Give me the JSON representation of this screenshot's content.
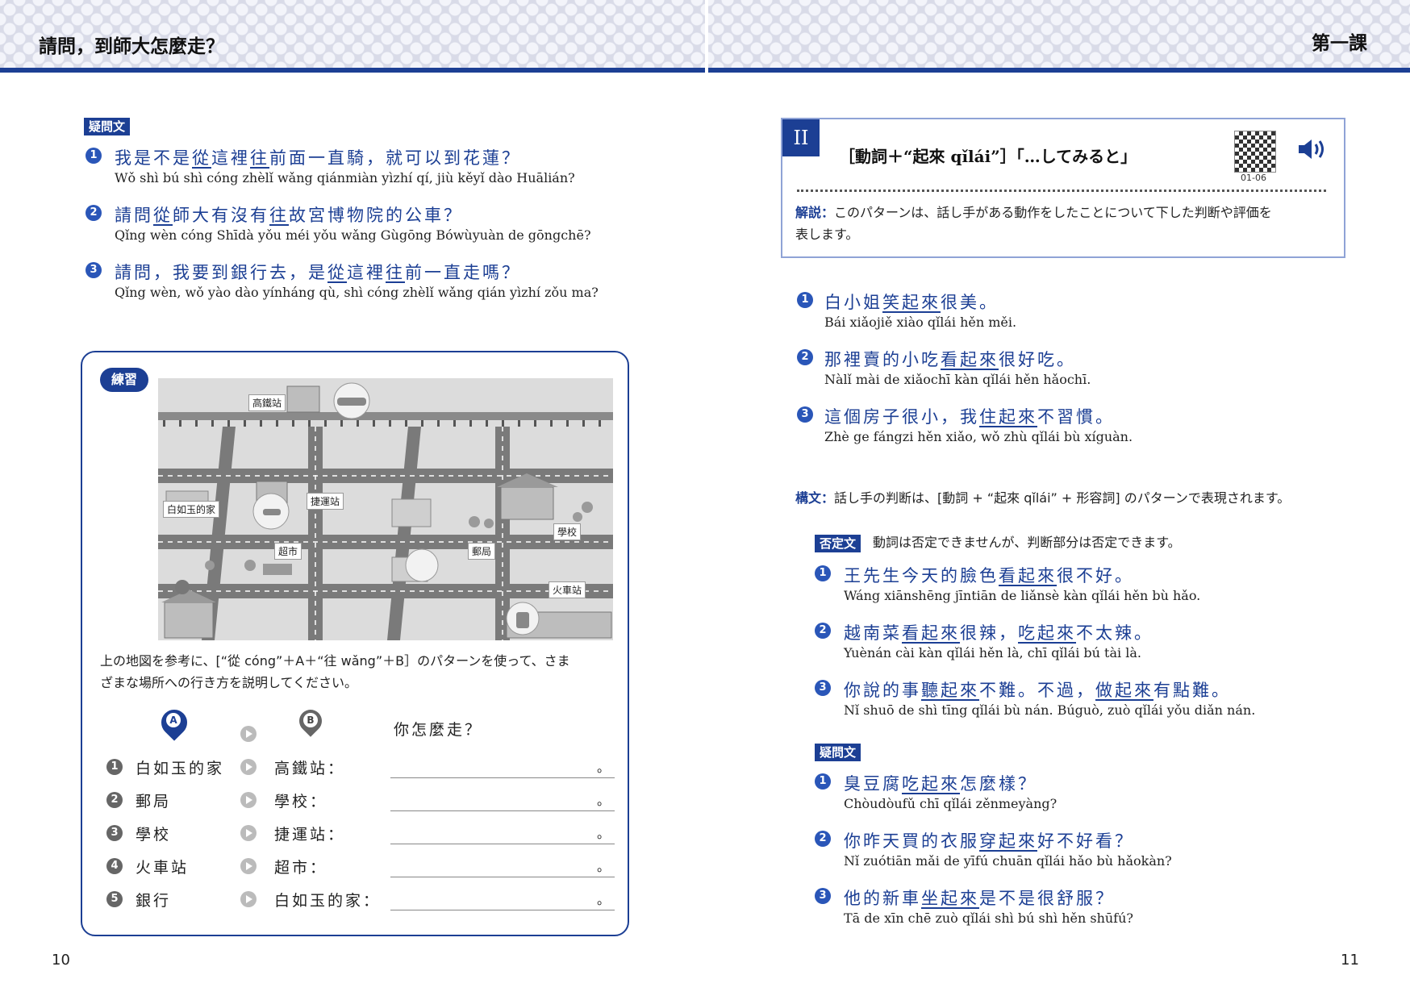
{
  "header": {
    "left_title": "請問，到師大怎麼走？",
    "right_title": "第一課"
  },
  "left": {
    "question_tag": "疑問文",
    "questions": [
      {
        "n": "❶",
        "zh_a": "我是不是",
        "zh_u1": "從",
        "zh_b": "這裡",
        "zh_u2": "往",
        "zh_c": "前面一直騎，就可以到花蓮？",
        "py": "Wǒ shì bú shì cóng zhèlǐ wǎng qiánmiàn yìzhí qí, jiù kěyǐ dào Huālián?"
      },
      {
        "n": "❷",
        "zh_a": "請問",
        "zh_u1": "從",
        "zh_b": "師大有沒有",
        "zh_u2": "往",
        "zh_c": "故宮博物院的公車？",
        "py": "Qǐng wèn cóng Shīdà yǒu méi yǒu wǎng Gùgōng Bówùyuàn de gōngchē?"
      },
      {
        "n": "❸",
        "zh_a": "請問，我要到銀行去，是",
        "zh_u1": "從",
        "zh_b": "這裡",
        "zh_u2": "往",
        "zh_c": "前一直走嗎？",
        "py": "Qǐng wèn, wǒ yào dào yínháng qù, shì cóng zhèlǐ wǎng qián yìzhí zǒu ma?"
      }
    ],
    "practice": {
      "tag": "練習",
      "map_labels": {
        "hsr": "高鐵站",
        "home": "白如玉的家",
        "mrt": "捷運站",
        "school": "學校",
        "market": "超市",
        "post": "郵局",
        "train": "火車站"
      },
      "instruction_1": "上の地図を参考に、[“從 cóng”＋A＋“往 wǎng”＋B］のパターンを使って、さま",
      "instruction_2": "ざまな場所への行き方を説明してください。",
      "pin_a": "A",
      "pin_b": "B",
      "question": "你怎麼走？",
      "rows": [
        {
          "n": "❶",
          "a": "白如玉的家",
          "b": "高鐵站：",
          "end": "。"
        },
        {
          "n": "❷",
          "a": "郵局",
          "b": "學校：",
          "end": "。"
        },
        {
          "n": "❸",
          "a": "學校",
          "b": "捷運站：",
          "end": "。"
        },
        {
          "n": "❹",
          "a": "火車站",
          "b": "超市：",
          "end": "。"
        },
        {
          "n": "❺",
          "a": "銀行",
          "b": "白如玉的家：",
          "end": "。"
        }
      ]
    },
    "page": "10"
  },
  "right": {
    "pattern": {
      "roman": "II",
      "title": "［動詞＋“起來 qǐlái”］「…してみると」",
      "code": "01-06",
      "expl_label": "解説：",
      "expl_1": "このパターンは、話し手がある動作をしたことについて下した判断や評価を",
      "expl_2": "表します。"
    },
    "examples": [
      {
        "n": "❶",
        "a": "白小姐",
        "u": "笑起來",
        "b": "很美。",
        "py": "Bái xiǎojiě xiào qǐlái hěn měi."
      },
      {
        "n": "❷",
        "a": "那裡賣的小吃",
        "u": "看起來",
        "b": "很好吃。",
        "py": "Nàlǐ mài de xiǎochī kàn qǐlái hěn hǎochī."
      },
      {
        "n": "❸",
        "a": "這個房子很小，我",
        "u": "住起來",
        "b": "不習慣。",
        "py": "Zhè ge fángzi hěn xiǎo, wǒ zhù qǐlái bù xíguàn."
      }
    ],
    "structure_label": "構文：",
    "structure_text": "話し手の判断は、[動詞 + “起來 qǐlái” + 形容詞] のパターンで表現されます。",
    "neg_tag": "否定文",
    "neg_text": "動詞は否定できませんが、判断部分は否定できます。",
    "neg_examples": [
      {
        "n": "❶",
        "a": "王先生今天的臉色",
        "u": "看起來",
        "b": "很不好。",
        "u2": "",
        "c": "",
        "py": "Wáng xiānshēng jīntiān de liǎnsè kàn qǐlái hěn bù hǎo."
      },
      {
        "n": "❷",
        "a": "越南菜",
        "u": "看起來",
        "b": "很辣，",
        "u2": "吃起來",
        "c": "不太辣。",
        "py": "Yuènán cài kàn qǐlái hěn là, chī qǐlái bú tài là."
      },
      {
        "n": "❸",
        "a": "你說的事",
        "u": "聽起來",
        "b": "不難。不過，",
        "u2": "做起來",
        "c": "有點難。",
        "py": "Nǐ shuō de shì tīng qǐlái bù nán. Búguò, zuò qǐlái yǒu diǎn nán."
      }
    ],
    "q_tag": "疑問文",
    "q_examples": [
      {
        "n": "❶",
        "a": "臭豆腐",
        "u": "吃起來",
        "b": "怎麼樣？",
        "py": "Chòudòufǔ chī qǐlái zěnmeyàng?"
      },
      {
        "n": "❷",
        "a": "你昨天買的衣服",
        "u": "穿起來",
        "b": "好不好看？",
        "py": "Nǐ zuótiān mǎi de yīfú chuān qǐlái hǎo bù hǎokàn?"
      },
      {
        "n": "❸",
        "a": "他的新車",
        "u": "坐起來",
        "b": "是不是很舒服？",
        "py": "Tā de xīn chē zuò qǐlái shì bú shì hěn shūfú?"
      }
    ],
    "page": "11"
  }
}
